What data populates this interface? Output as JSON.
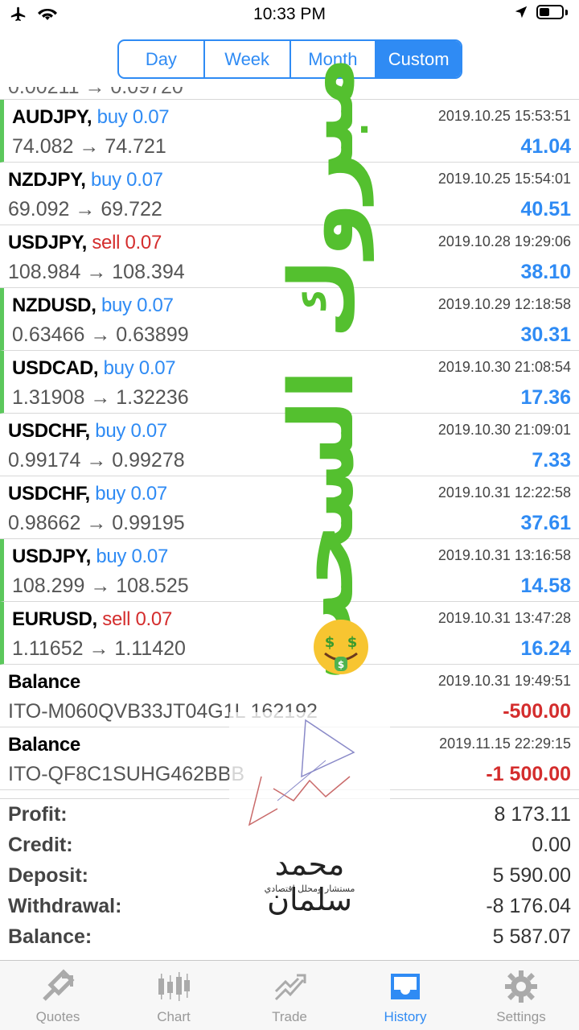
{
  "status_bar": {
    "time": "10:33 PM"
  },
  "segments": [
    {
      "label": "Day",
      "active": false
    },
    {
      "label": "Week",
      "active": false
    },
    {
      "label": "Month",
      "active": false
    },
    {
      "label": "Custom",
      "active": true
    }
  ],
  "partial_row": {
    "text": "0.00211 → 0.09720"
  },
  "trades": [
    {
      "symbol": "AUDJPY,",
      "action": "buy 0.07",
      "side": "buy",
      "prices": "74.082 → 74.721",
      "time": "2019.10.25 15:53:51",
      "profit": "41.04"
    },
    {
      "symbol": "NZDJPY,",
      "action": "buy 0.07",
      "side": "buy",
      "prices": "69.092 → 69.722",
      "time": "2019.10.25 15:54:01",
      "profit": "40.51"
    },
    {
      "symbol": "USDJPY,",
      "action": "sell 0.07",
      "side": "sell",
      "prices": "108.984 → 108.394",
      "time": "2019.10.28 19:29:06",
      "profit": "38.10"
    },
    {
      "symbol": "NZDUSD,",
      "action": "buy 0.07",
      "side": "buy",
      "prices": "0.63466 → 0.63899",
      "time": "2019.10.29 12:18:58",
      "profit": "30.31"
    },
    {
      "symbol": "USDCAD,",
      "action": "buy 0.07",
      "side": "buy",
      "prices": "1.31908 → 1.32236",
      "time": "2019.10.30 21:08:54",
      "profit": "17.36"
    },
    {
      "symbol": "USDCHF,",
      "action": "buy 0.07",
      "side": "buy",
      "prices": "0.99174 → 0.99278",
      "time": "2019.10.30 21:09:01",
      "profit": "7.33"
    },
    {
      "symbol": "USDCHF,",
      "action": "buy 0.07",
      "side": "buy",
      "prices": "0.98662 → 0.99195",
      "time": "2019.10.31 12:22:58",
      "profit": "37.61"
    },
    {
      "symbol": "USDJPY,",
      "action": "buy 0.07",
      "side": "buy",
      "prices": "108.299 → 108.525",
      "time": "2019.10.31 13:16:58",
      "profit": "14.58"
    },
    {
      "symbol": "EURUSD,",
      "action": "sell 0.07",
      "side": "sell",
      "prices": "1.11652 → 1.11420",
      "time": "2019.10.31 13:47:28",
      "profit": "16.24"
    }
  ],
  "balance_ops": [
    {
      "label": "Balance",
      "ref": "ITO-M060QVB33JT04G1L 162192",
      "time": "2019.10.31 19:49:51",
      "amount": "-500.00"
    },
    {
      "label": "Balance",
      "ref": "ITO-QF8C1SUHG462BBB",
      "time": "2019.11.15 22:29:15",
      "amount": "-1 500.00"
    }
  ],
  "summary": [
    {
      "label": "Profit:",
      "value": "8 173.11"
    },
    {
      "label": "Credit:",
      "value": "0.00"
    },
    {
      "label": "Deposit:",
      "value": "5 590.00"
    },
    {
      "label": "Withdrawal:",
      "value": "-8 176.04"
    },
    {
      "label": "Balance:",
      "value": "5 587.07"
    }
  ],
  "tabs": [
    {
      "label": "Quotes",
      "icon": "quotes-icon",
      "active": false
    },
    {
      "label": "Chart",
      "icon": "chart-icon",
      "active": false
    },
    {
      "label": "Trade",
      "icon": "trade-icon",
      "active": false
    },
    {
      "label": "History",
      "icon": "history-icon",
      "active": true
    },
    {
      "label": "Settings",
      "icon": "gear-icon",
      "active": false
    }
  ],
  "overlay": {
    "caption": "مبروك السحب",
    "watermark_name": "محمد سلمان",
    "watermark_sub": "مستشار ومحلل إقتصادي"
  },
  "colors": {
    "accent": "#2f8bf4",
    "loss": "#d42d2d",
    "profit_bar": "#5cc85c",
    "overlay_green": "#54c02f"
  }
}
